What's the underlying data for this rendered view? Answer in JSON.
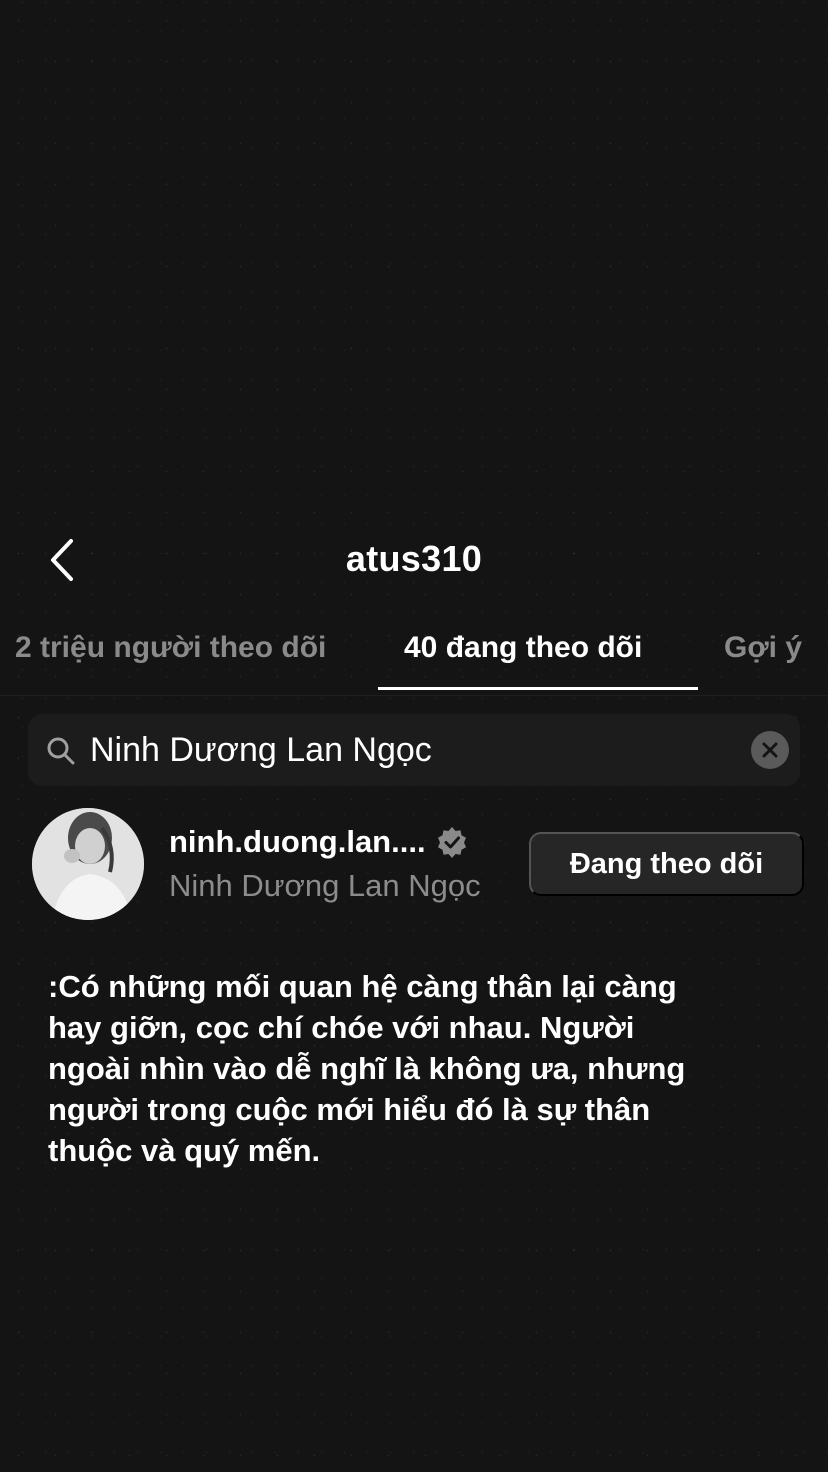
{
  "header": {
    "title": "atus310",
    "back_icon": "chevron-left-icon"
  },
  "tabs": [
    {
      "label": "2 triệu người theo dõi",
      "active": false
    },
    {
      "label": "40 đang theo dõi",
      "active": true
    },
    {
      "label": "Gợi ý",
      "active": false
    }
  ],
  "search": {
    "value": "Ninh Dương Lan Ngọc",
    "icon": "search-icon",
    "clear_icon": "clear-icon"
  },
  "result": {
    "username": "ninh.duong.lan....",
    "full_name": "Ninh Dương Lan Ngọc",
    "verified": true,
    "follow_button_label": "Đang theo dõi"
  },
  "caption": {
    "text": ":Có những mối quan hệ càng thân lại càng hay giỡn, cọc chí chóe với nhau. Người ngoài nhìn vào dễ nghĩ là không ưa, nhưng người trong cuộc mới hiểu đó là sự thân thuộc và quý mến."
  },
  "colors": {
    "background": "#141414",
    "inactive_tab": "#8a8a8a",
    "secondary_text": "#8c8c8c",
    "button_bg": "#262626",
    "search_bg": "#1c1c1c"
  }
}
